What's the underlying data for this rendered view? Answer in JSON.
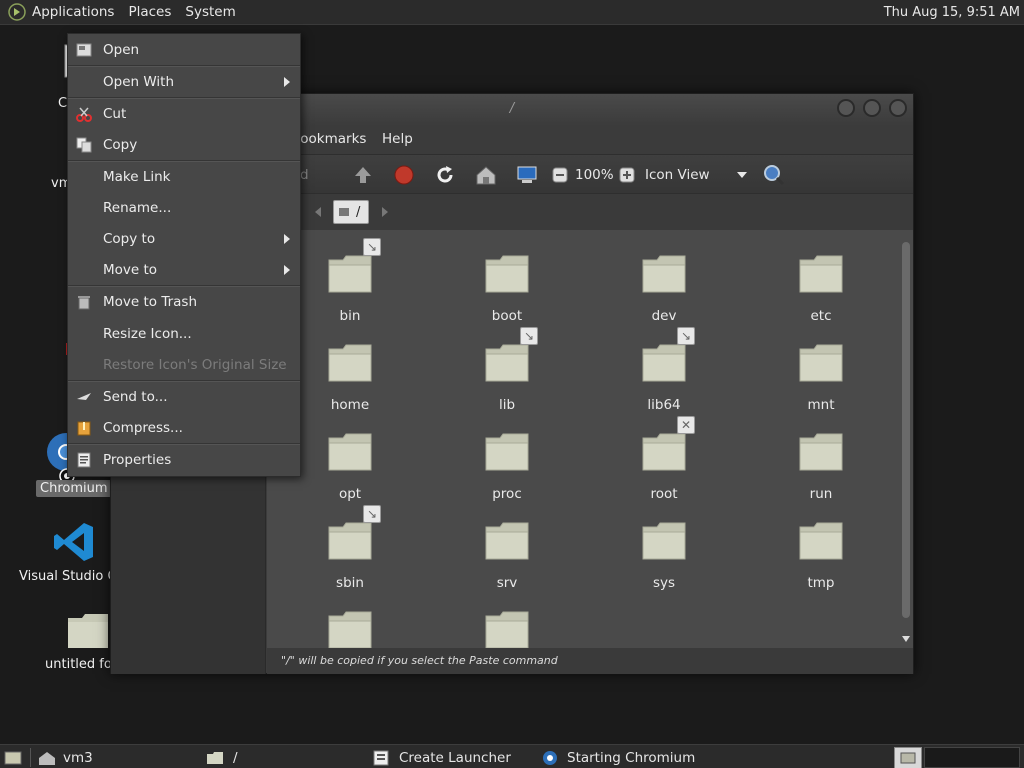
{
  "top_panel": {
    "applications": "Applications",
    "places": "Places",
    "system": "System",
    "clock": "Thu Aug 15,  9:51 AM"
  },
  "desktop": {
    "icons": [
      {
        "label": "C",
        "icon": "computer-icon"
      },
      {
        "label": "vm",
        "icon": "home-folder-icon"
      },
      {
        "label": "Chromium",
        "icon": "chromium-icon"
      },
      {
        "label": "Visual Studio Co",
        "icon": "vscode-icon"
      },
      {
        "label": "untitled fol",
        "icon": "folder-icon"
      }
    ]
  },
  "file_manager": {
    "title": "/",
    "menus": [
      "Bookmarks",
      "Help"
    ],
    "toolbar": {
      "back_partial": "d",
      "zoom": "100%",
      "view_mode": "Icon View"
    },
    "location": "/",
    "status": "\"/\" will be copied if you select the Paste command",
    "files": [
      {
        "name": "bin",
        "badge": "link"
      },
      {
        "name": "boot",
        "badge": ""
      },
      {
        "name": "dev",
        "badge": ""
      },
      {
        "name": "etc",
        "badge": ""
      },
      {
        "name": "home",
        "badge": ""
      },
      {
        "name": "lib",
        "badge": "link"
      },
      {
        "name": "lib64",
        "badge": "link"
      },
      {
        "name": "mnt",
        "badge": ""
      },
      {
        "name": "opt",
        "badge": ""
      },
      {
        "name": "proc",
        "badge": ""
      },
      {
        "name": "root",
        "badge": "no-access"
      },
      {
        "name": "run",
        "badge": ""
      },
      {
        "name": "sbin",
        "badge": "link"
      },
      {
        "name": "srv",
        "badge": ""
      },
      {
        "name": "sys",
        "badge": ""
      },
      {
        "name": "tmp",
        "badge": ""
      },
      {
        "name": "",
        "badge": ""
      },
      {
        "name": "",
        "badge": ""
      }
    ]
  },
  "context_menu": {
    "items": [
      {
        "label": "Open",
        "icon": "open-icon",
        "submenu": false,
        "disabled": false
      },
      {
        "label": "Open With",
        "icon": "",
        "submenu": true,
        "disabled": false
      },
      {
        "label": "Cut",
        "icon": "scissors-icon",
        "submenu": false,
        "disabled": false
      },
      {
        "label": "Copy",
        "icon": "copy-icon",
        "submenu": false,
        "disabled": false
      },
      {
        "label": "Make Link",
        "icon": "",
        "submenu": false,
        "disabled": false
      },
      {
        "label": "Rename...",
        "icon": "",
        "submenu": false,
        "disabled": false
      },
      {
        "label": "Copy to",
        "icon": "",
        "submenu": true,
        "disabled": false
      },
      {
        "label": "Move to",
        "icon": "",
        "submenu": true,
        "disabled": false
      },
      {
        "label": "Move to Trash",
        "icon": "trash-icon",
        "submenu": false,
        "disabled": false
      },
      {
        "label": "Resize Icon...",
        "icon": "",
        "submenu": false,
        "disabled": false
      },
      {
        "label": "Restore Icon's Original Size",
        "icon": "",
        "submenu": false,
        "disabled": true
      },
      {
        "label": "Send to...",
        "icon": "send-icon",
        "submenu": false,
        "disabled": false
      },
      {
        "label": "Compress...",
        "icon": "archive-icon",
        "submenu": false,
        "disabled": false
      },
      {
        "label": "Properties",
        "icon": "properties-icon",
        "submenu": false,
        "disabled": false
      }
    ]
  },
  "bottom_panel": {
    "tasks": [
      {
        "label": "vm3",
        "icon": "home-folder-icon"
      },
      {
        "label": "/",
        "icon": "folder-icon"
      },
      {
        "label": "Create Launcher",
        "icon": "launcher-icon"
      },
      {
        "label": "Starting Chromium",
        "icon": "chromium-icon"
      }
    ]
  },
  "colors": {
    "folder_fill": "#d4d6c4",
    "stop_red": "#c0392b",
    "vscode_blue": "#1f8ad2"
  }
}
